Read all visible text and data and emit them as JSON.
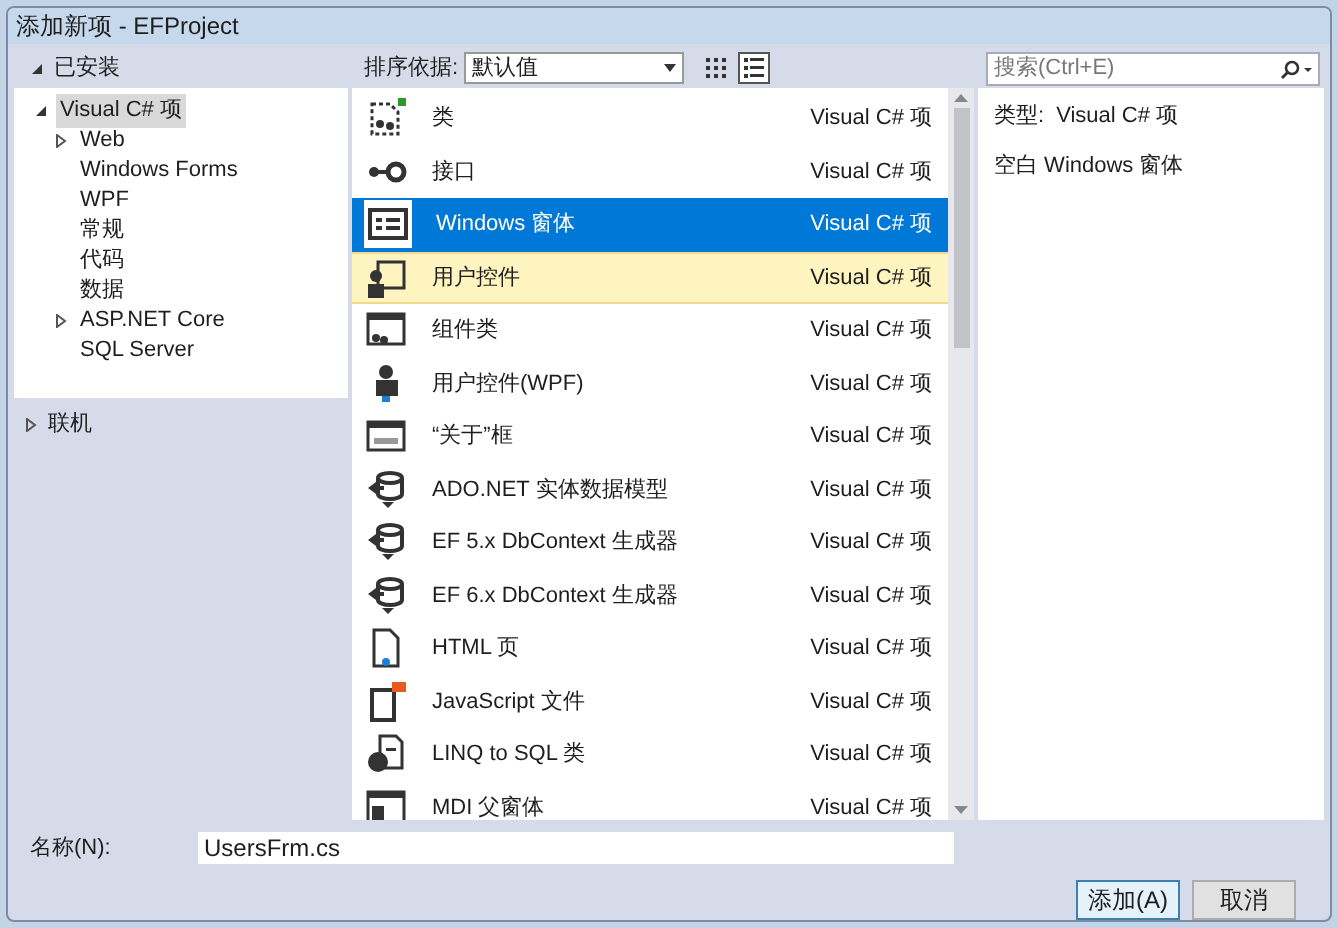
{
  "window": {
    "title": "添加新项 - EFProject"
  },
  "tree": {
    "label": "已安装",
    "expanded": true,
    "children": [
      {
        "label": "Visual C# 项",
        "expanded": true,
        "selected": true,
        "children": [
          {
            "label": "Web",
            "expandable": true,
            "selected": false
          },
          {
            "label": "Windows Forms",
            "expandable": false,
            "selected": false
          },
          {
            "label": "WPF",
            "expandable": false,
            "selected": false
          },
          {
            "label": "常规",
            "expandable": false,
            "selected": false
          },
          {
            "label": "代码",
            "expandable": false,
            "selected": false
          },
          {
            "label": "数据",
            "expandable": false,
            "selected": false
          },
          {
            "label": "ASP.NET Core",
            "expandable": true,
            "selected": false
          },
          {
            "label": "SQL Server",
            "expandable": false,
            "selected": false
          }
        ]
      }
    ]
  },
  "online": {
    "label": "联机",
    "expanded": false
  },
  "sort": {
    "label": "排序依据:",
    "value": "默认值"
  },
  "view_toggle": [
    {
      "kind": "grid",
      "selected": false
    },
    {
      "kind": "list",
      "selected": true
    }
  ],
  "search": {
    "placeholder": "搜索(Ctrl+E)"
  },
  "templates": [
    {
      "kind": "class",
      "name": "类",
      "type": "Visual C# 项",
      "selected": false,
      "highlighted": false
    },
    {
      "kind": "interface",
      "name": "接口",
      "type": "Visual C# 项",
      "selected": false,
      "highlighted": false
    },
    {
      "kind": "form",
      "name": "Windows 窗体",
      "type": "Visual C# 项",
      "selected": true,
      "highlighted": false
    },
    {
      "kind": "usercontrol",
      "name": "用户控件",
      "type": "Visual C# 项",
      "selected": false,
      "highlighted": true
    },
    {
      "kind": "component",
      "name": "组件类",
      "type": "Visual C# 项",
      "selected": false,
      "highlighted": false
    },
    {
      "kind": "wpf",
      "name": "用户控件(WPF)",
      "type": "Visual C# 项",
      "selected": false,
      "highlighted": false
    },
    {
      "kind": "about",
      "name": "“关于”框",
      "type": "Visual C# 项",
      "selected": false,
      "highlighted": false
    },
    {
      "kind": "data",
      "name": "ADO.NET 实体数据模型",
      "type": "Visual C# 项",
      "selected": false,
      "highlighted": false
    },
    {
      "kind": "data",
      "name": "EF 5.x DbContext 生成器",
      "type": "Visual C# 项",
      "selected": false,
      "highlighted": false
    },
    {
      "kind": "data",
      "name": "EF 6.x DbContext 生成器",
      "type": "Visual C# 项",
      "selected": false,
      "highlighted": false
    },
    {
      "kind": "html",
      "name": "HTML 页",
      "type": "Visual C# 项",
      "selected": false,
      "highlighted": false
    },
    {
      "kind": "js",
      "name": "JavaScript 文件",
      "type": "Visual C# 项",
      "selected": false,
      "highlighted": false
    },
    {
      "kind": "linq",
      "name": "LINQ to SQL 类",
      "type": "Visual C# 项",
      "selected": false,
      "highlighted": false
    },
    {
      "kind": "mdi",
      "name": "MDI 父窗体",
      "type": "Visual C# 项",
      "selected": false,
      "highlighted": false
    }
  ],
  "details": {
    "type_label": "类型:",
    "type_value": "Visual C# 项",
    "description": "空白 Windows 窗体"
  },
  "name_field": {
    "label": "名称(N):",
    "value": "UsersFrm.cs"
  },
  "buttons": [
    {
      "label": "添加(A)",
      "default": true
    },
    {
      "label": "取消",
      "default": false
    }
  ]
}
